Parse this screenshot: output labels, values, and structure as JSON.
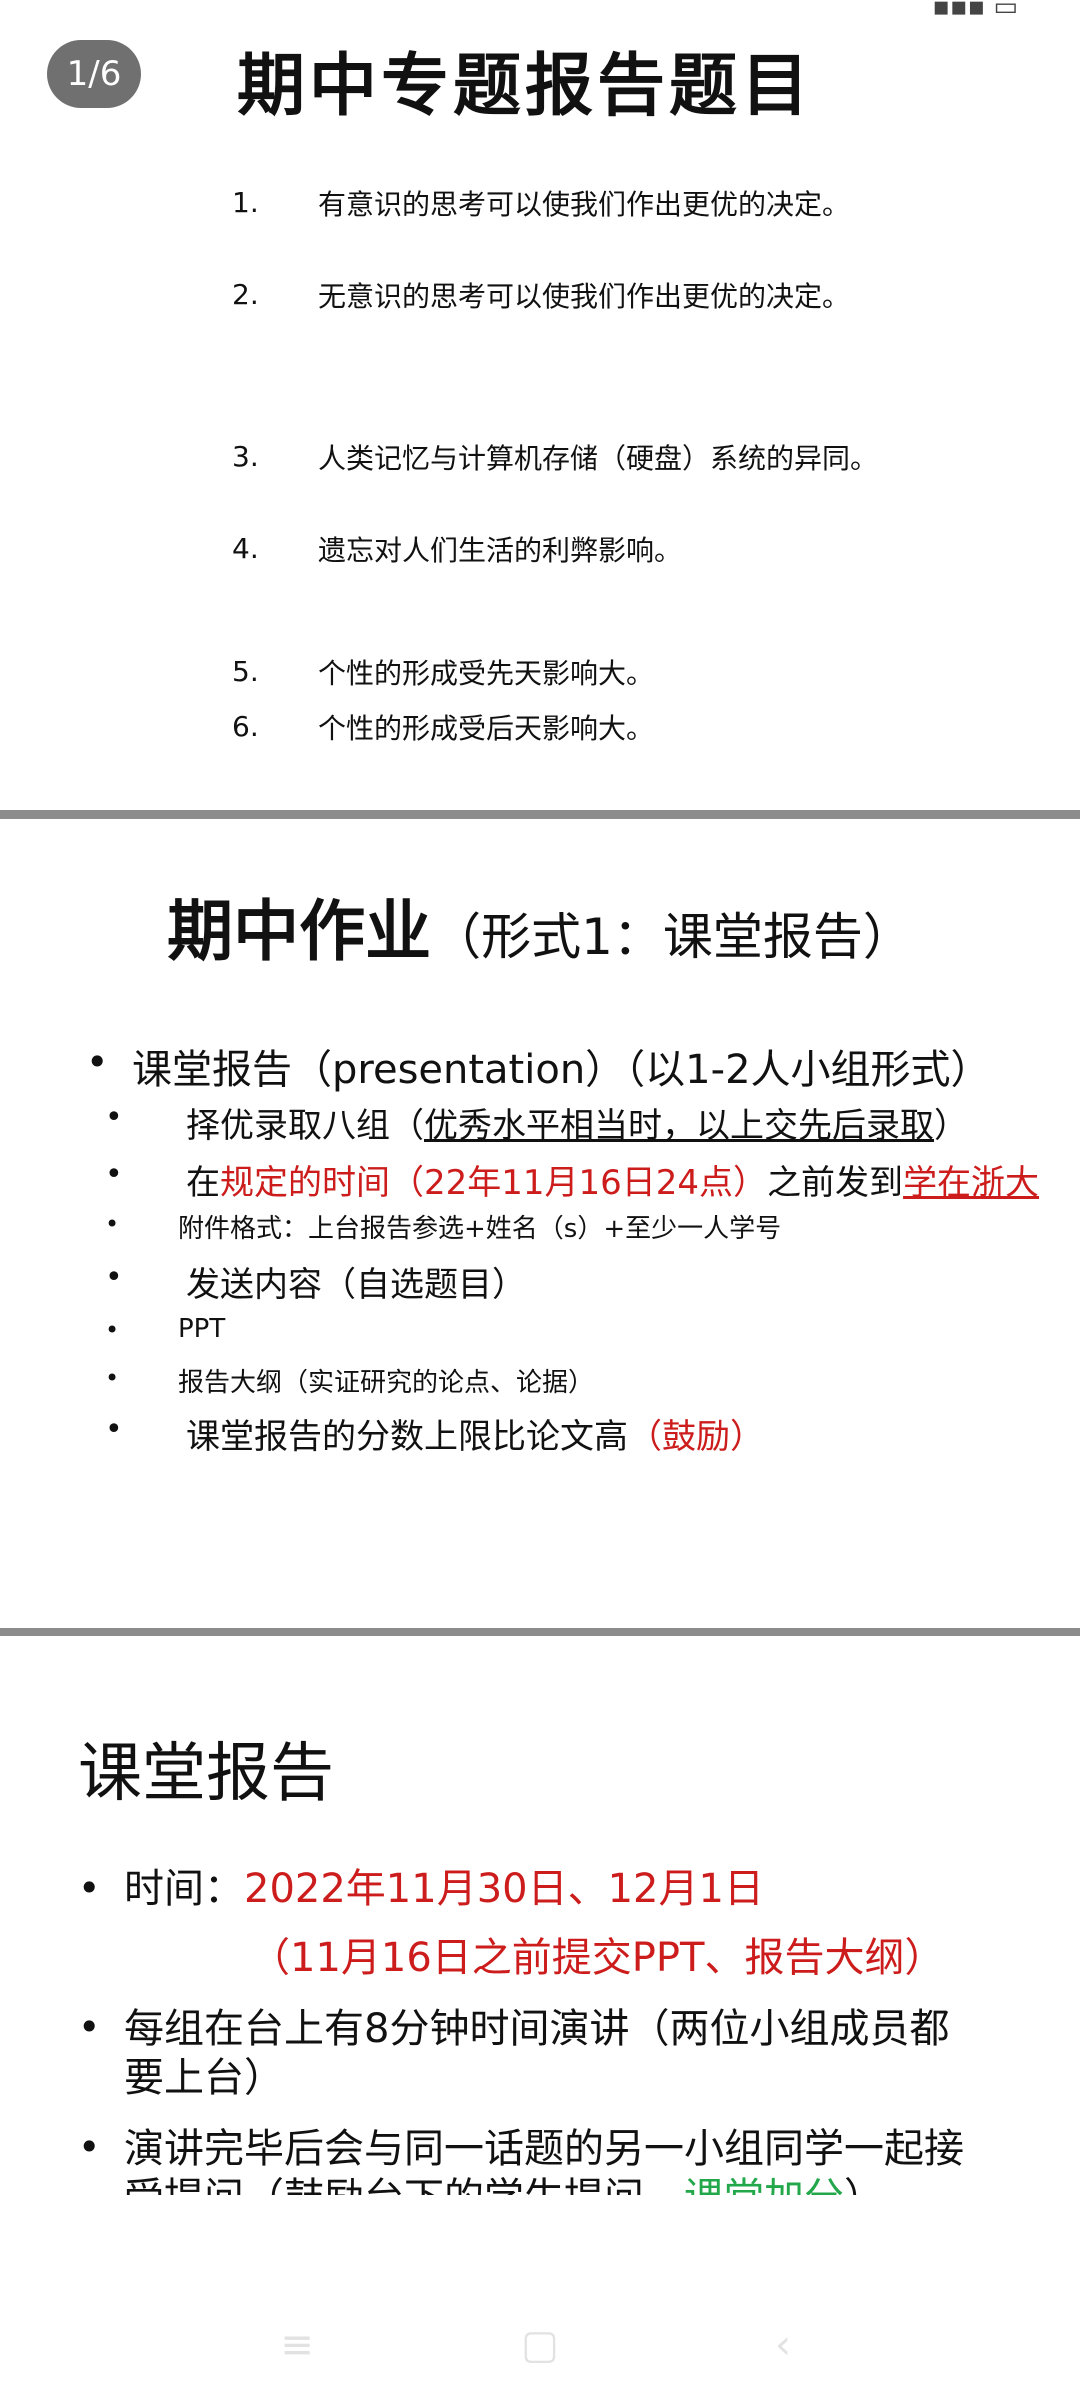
{
  "page_badge": "1/6",
  "slide1": {
    "title": "期中专题报告题目",
    "items": [
      {
        "num": "1.",
        "text": "有意识的思考可以使我们作出更优的决定。"
      },
      {
        "num": "2.",
        "text": "无意识的思考可以使我们作出更优的决定。"
      },
      {
        "num": "3.",
        "text": "人类记忆与计算机存储（硬盘）系统的异同。"
      },
      {
        "num": "4.",
        "text": "遗忘对人们生活的利弊影响。"
      },
      {
        "num": "5.",
        "text": "个性的形成受先天影响大。"
      },
      {
        "num": "6.",
        "text": "个性的形成受后天影响大。"
      }
    ]
  },
  "slide2": {
    "title_main": "期中作业",
    "title_sub": "（形式1：课堂报告）",
    "line1": "课堂报告（presentation）（以1-2人小组形式）",
    "line2_a": "择优录取八组（",
    "line2_b": "优秀水平相当时，以上交先后录取",
    "line2_c": "）",
    "line3_a": "在",
    "line3_b": "规定的时间（22年11月16日24点）",
    "line3_c": "之前发到",
    "line3_d": "学在浙大",
    "line4": "附件格式：上台报告参选+姓名（s）+至少一人学号",
    "line5": "发送内容（自选题目）",
    "line6": "PPT",
    "line7": "报告大纲（实证研究的论点、论据）",
    "line8_a": "课堂报告的分数上限比论文高",
    "line8_b": "（鼓励）"
  },
  "slide3": {
    "title": "课堂报告",
    "time_label": "时间：",
    "time_value": "2022年11月30日、12月1日",
    "time_note": "（11月16日之前提交PPT、报告大纲）",
    "b2_line1": "每组在台上有8分钟时间演讲（两位小组成员都",
    "b2_line2": "要上台）",
    "b3_line1": "演讲完毕后会与同一话题的另一小组同学一起接",
    "b3_line2_a": "受提问（鼓励台下的学生提问—",
    "b3_line2_b": "课堂加分",
    "b3_line2_c": "）"
  },
  "navbar": {
    "menu_icon": "≡",
    "home_icon": "▢",
    "back_icon": "‹"
  },
  "colors": {
    "accent_red": "#cc1c1c",
    "accent_green": "#22a84a",
    "badge_bg": "#707070",
    "separator": "#8c8c8c"
  }
}
